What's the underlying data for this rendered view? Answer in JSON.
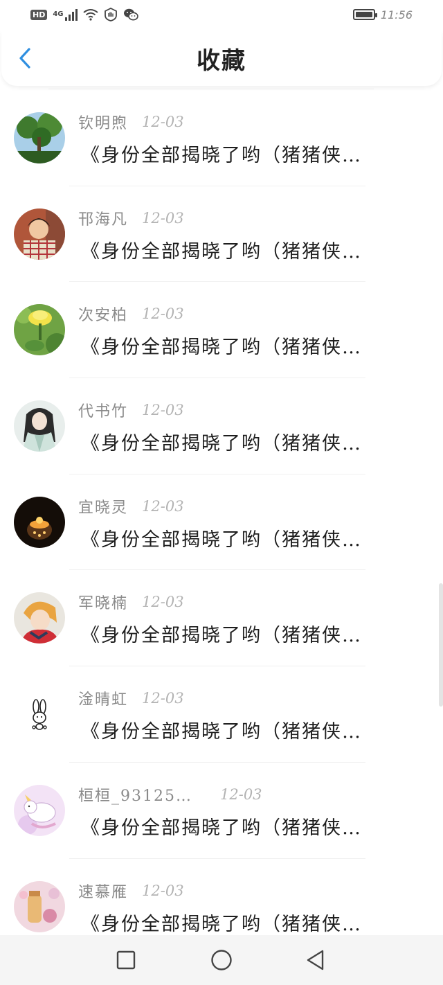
{
  "status_bar": {
    "hd_label": "HD",
    "network_label": "4G",
    "time": "11:56"
  },
  "header": {
    "title": "收藏",
    "back_icon": "chevron-left-icon"
  },
  "favorites": [
    {
      "name": "钦明煦",
      "date": "12-03",
      "excerpt": "《身份全部揭晓了哟（猪猪侠…",
      "avatar": "trees-photo"
    },
    {
      "name": "邗海凡",
      "date": "12-03",
      "excerpt": "《身份全部揭晓了哟（猪猪侠…",
      "avatar": "child-photo"
    },
    {
      "name": "次安柏",
      "date": "12-03",
      "excerpt": "《身份全部揭晓了哟（猪猪侠…",
      "avatar": "yellow-flower-photo"
    },
    {
      "name": "代书竹",
      "date": "12-03",
      "excerpt": "《身份全部揭晓了哟（猪猪侠…",
      "avatar": "anime-character"
    },
    {
      "name": "宜晓灵",
      "date": "12-03",
      "excerpt": "《身份全部揭晓了哟（猪猪侠…",
      "avatar": "candle-photo"
    },
    {
      "name": "军晓楠",
      "date": "12-03",
      "excerpt": "《身份全部揭晓了哟（猪猪侠…",
      "avatar": "anime-boy"
    },
    {
      "name": "淦晴虹",
      "date": "12-03",
      "excerpt": "《身份全部揭晓了哟（猪猪侠…",
      "avatar": "rabbit-doodle"
    },
    {
      "name": "桓桓_93125…",
      "date": "12-03",
      "excerpt": "《身份全部揭晓了哟（猪猪侠…",
      "avatar": "unicorn-cartoon"
    },
    {
      "name": "速慕雁",
      "date": "12-03",
      "excerpt": "《身份全部揭晓了哟（猪猪侠…",
      "avatar": "jar-photo"
    }
  ],
  "nav_bar": {
    "recent_icon": "square-icon",
    "home_icon": "circle-icon",
    "back_icon": "triangle-back-icon"
  },
  "colors": {
    "accent": "#2f8fe0",
    "title_text": "#222222",
    "name_text": "#8a8a8a",
    "date_text": "#b3b3b3",
    "excerpt_text": "#1e1e1e"
  }
}
